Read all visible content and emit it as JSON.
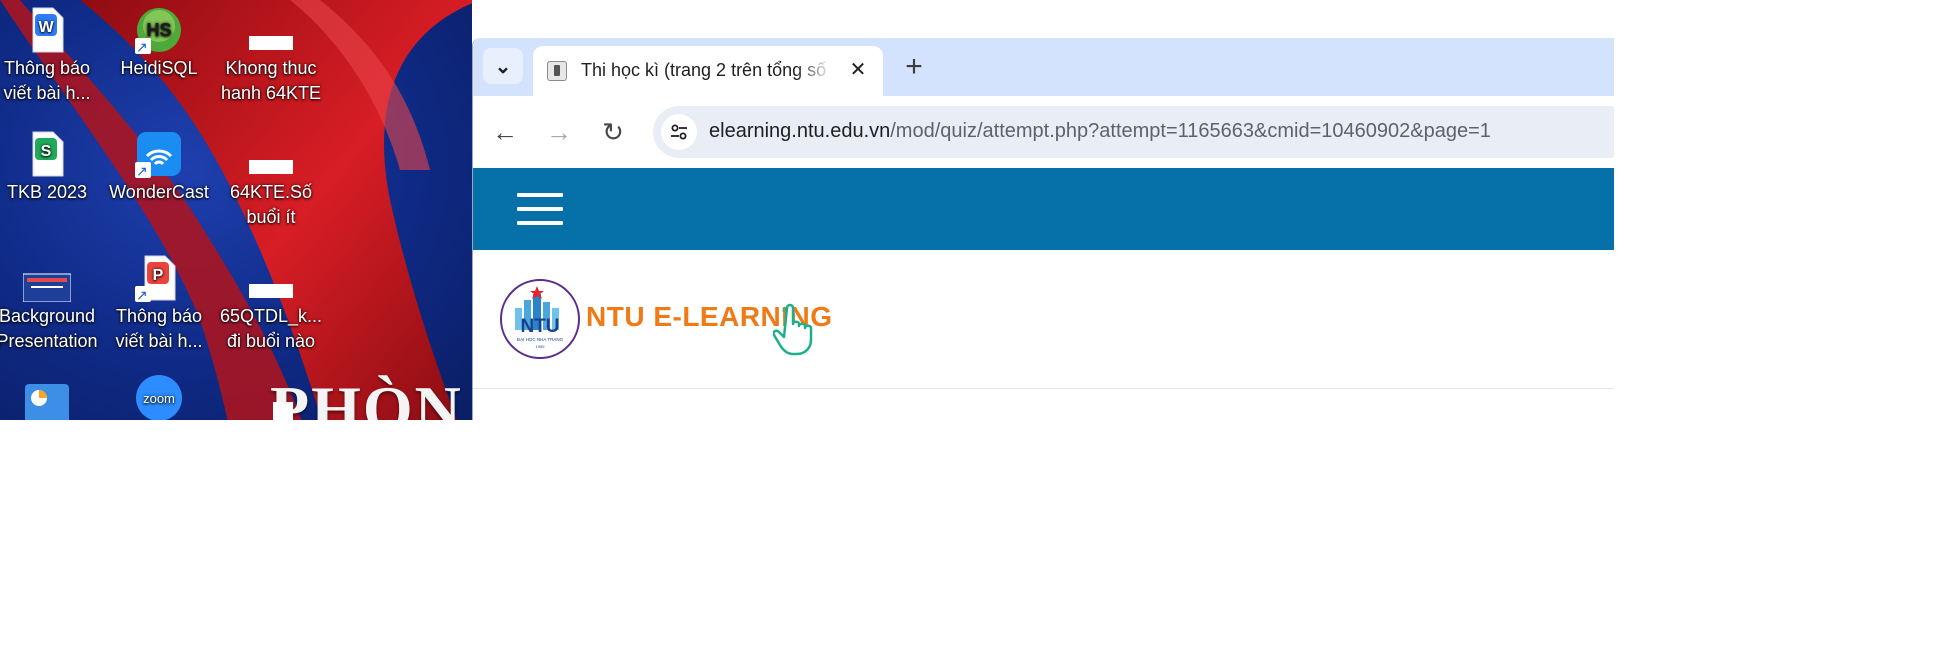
{
  "desktop": {
    "icons": [
      {
        "label": "Thông báo viết bài h...",
        "icon": "wps-writer-doc-icon"
      },
      {
        "label": "HeidiSQL",
        "icon": "heidisql-icon"
      },
      {
        "label": "Khong thuc hanh 64KTE",
        "icon": "blank-file-icon"
      },
      {
        "label": "TKB 2023",
        "icon": "wps-spreadsheet-icon"
      },
      {
        "label": "WonderCast",
        "icon": "wondercast-icon"
      },
      {
        "label": "64KTE.Số buổi ít",
        "icon": "blank-file-icon"
      },
      {
        "label": "Background Presentation",
        "icon": "presentation-thumbnail-icon"
      },
      {
        "label": "Thông báo viết bài h...",
        "icon": "wps-pdf-icon"
      },
      {
        "label": "65QTDL_k... đi buổi nào",
        "icon": "blank-file-icon"
      }
    ],
    "partial_icons": [
      "chart-app-icon",
      "zoom-icon",
      "blank-file-icon"
    ],
    "zoom_label": "zoom",
    "wallpaper_text": "PHÒN",
    "colors": {
      "wallpaper": "#0f2a86",
      "ribbon": "#c8161d"
    }
  },
  "browser": {
    "tab": {
      "title": "Thi học kì (trang 2 trên tổng số",
      "close": "✕"
    },
    "new_tab": "+",
    "tab_search": "⌄",
    "nav": {
      "back": "←",
      "forward": "→",
      "reload": "↻"
    },
    "url": {
      "host": "elearning.ntu.edu.vn",
      "path": "/mod/quiz/attempt.php?attempt=1165663&cmid=10460902&page=1"
    },
    "colors": {
      "tabstrip": "#d3e3fd",
      "navbar": "#0671a8",
      "brand_text": "#f07a16"
    }
  },
  "site": {
    "brand": "NTU E-LEARNING",
    "logo_text": "NTU",
    "logo_caption": "ĐẠI HỌC NHA TRANG",
    "logo_year": "1959"
  }
}
